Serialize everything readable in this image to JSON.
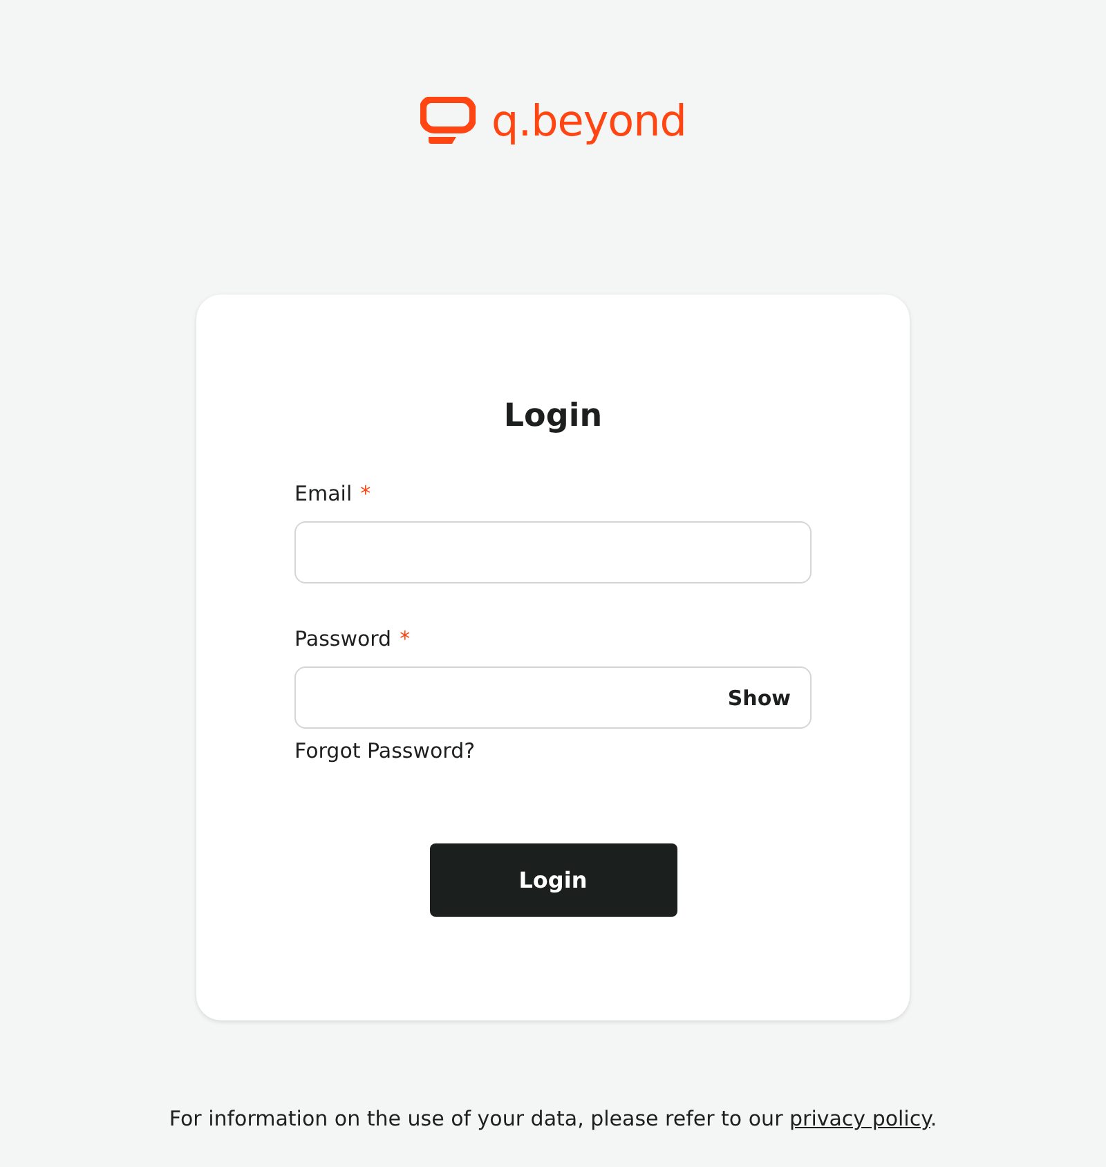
{
  "logo": {
    "text": "q.beyond"
  },
  "title": "Login",
  "fields": [
    {
      "label": "Email",
      "required_mark": "*",
      "kind": "text"
    },
    {
      "label": "Password",
      "required_mark": "*",
      "kind": "password",
      "toggle": "Show"
    }
  ],
  "forgot_link": "Forgot Password?",
  "submit": "Login",
  "footer": {
    "before": "For information on the use of your data, please refer to our ",
    "link": "privacy policy",
    "after": "."
  }
}
